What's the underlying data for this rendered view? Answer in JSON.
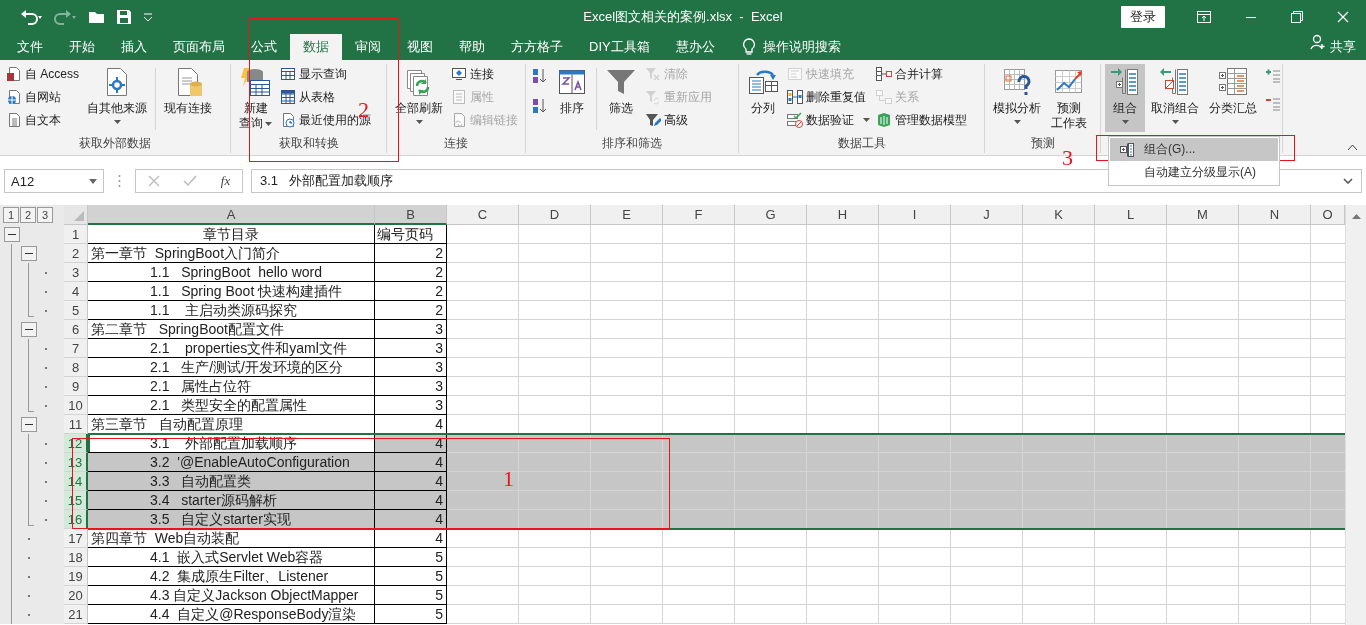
{
  "title_bar": {
    "title": "Excel图文相关的案例.xlsx  -  Excel",
    "sign_in": "登录",
    "redo_disabled": true
  },
  "tabs": [
    {
      "label": "文件",
      "selected": false
    },
    {
      "label": "开始",
      "selected": false
    },
    {
      "label": "插入",
      "selected": false
    },
    {
      "label": "页面布局",
      "selected": false
    },
    {
      "label": "公式",
      "selected": false
    },
    {
      "label": "数据",
      "selected": true
    },
    {
      "label": "审阅",
      "selected": false
    },
    {
      "label": "视图",
      "selected": false
    },
    {
      "label": "帮助",
      "selected": false
    },
    {
      "label": "方方格子",
      "selected": false
    },
    {
      "label": "DIY工具箱",
      "selected": false
    },
    {
      "label": "慧办公",
      "selected": false
    }
  ],
  "tell_me": "操作说明搜索",
  "share": "共享",
  "ribbon_groups": [
    {
      "label": "获取外部数据",
      "items": [
        {
          "kind": "stack",
          "items": [
            {
              "label": "自 Access",
              "disabled": false,
              "dropdown": false
            },
            {
              "label": "自网站",
              "disabled": false,
              "dropdown": false
            },
            {
              "label": "自文本",
              "disabled": false,
              "dropdown": false
            }
          ]
        },
        {
          "kind": "large",
          "lines": [
            "自其他来源"
          ],
          "dropdown": true,
          "pressed": false
        },
        {
          "kind": "separator"
        },
        {
          "kind": "large",
          "lines": [
            "现有连接"
          ],
          "dropdown": false,
          "pressed": false
        }
      ]
    },
    {
      "label": "获取和转换",
      "items": [
        {
          "kind": "large",
          "lines": [
            "新建",
            "查询"
          ],
          "dropdown": true,
          "pressed": false
        },
        {
          "kind": "stack",
          "items": [
            {
              "label": "显示查询",
              "disabled": false,
              "dropdown": false
            },
            {
              "label": "从表格",
              "disabled": false,
              "dropdown": false
            },
            {
              "label": "最近使用的源",
              "disabled": false,
              "dropdown": false
            }
          ]
        }
      ]
    },
    {
      "label": "连接",
      "items": [
        {
          "kind": "large",
          "lines": [
            "全部刷新"
          ],
          "dropdown": true,
          "pressed": false
        },
        {
          "kind": "stack",
          "items": [
            {
              "label": "连接",
              "disabled": false,
              "dropdown": false
            },
            {
              "label": "属性",
              "disabled": true,
              "dropdown": false
            },
            {
              "label": "编辑链接",
              "disabled": true,
              "dropdown": false
            }
          ]
        }
      ]
    },
    {
      "label": "排序和筛选",
      "items": [
        {
          "kind": "sort-icons"
        },
        {
          "kind": "large",
          "lines": [
            "排序"
          ],
          "dropdown": false,
          "pressed": false
        },
        {
          "kind": "separator"
        },
        {
          "kind": "large",
          "lines": [
            "筛选"
          ],
          "dropdown": false,
          "pressed": false
        },
        {
          "kind": "stack",
          "items": [
            {
              "label": "清除",
              "disabled": true,
              "dropdown": false
            },
            {
              "label": "重新应用",
              "disabled": true,
              "dropdown": false
            },
            {
              "label": "高级",
              "disabled": false,
              "dropdown": false
            }
          ]
        }
      ]
    },
    {
      "label": "数据工具",
      "items": [
        {
          "kind": "large",
          "lines": [
            "分列"
          ],
          "dropdown": false,
          "pressed": false
        },
        {
          "kind": "stack",
          "items": [
            {
              "label": "快速填充",
              "disabled": true,
              "dropdown": false
            },
            {
              "label": "删除重复值",
              "disabled": false,
              "dropdown": false
            },
            {
              "label": "数据验证",
              "disabled": false,
              "dropdown": true
            }
          ]
        },
        {
          "kind": "stack",
          "items": [
            {
              "label": "合并计算",
              "disabled": false,
              "dropdown": false
            },
            {
              "label": "关系",
              "disabled": true,
              "dropdown": false
            },
            {
              "label": "管理数据模型",
              "disabled": false,
              "dropdown": false
            }
          ]
        }
      ]
    },
    {
      "label": "预测",
      "items": [
        {
          "kind": "large",
          "lines": [
            "模拟分析"
          ],
          "dropdown": true,
          "pressed": false
        },
        {
          "kind": "large",
          "lines": [
            "预测",
            "工作表"
          ],
          "dropdown": false,
          "pressed": false
        }
      ]
    },
    {
      "items": [
        {
          "kind": "large",
          "lines": [
            "组合"
          ],
          "dropdown": true,
          "pressed": true
        },
        {
          "kind": "large",
          "lines": [
            "取消组合"
          ],
          "dropdown": true,
          "pressed": false
        },
        {
          "kind": "large",
          "lines": [
            "分类汇总"
          ],
          "dropdown": false,
          "pressed": false
        },
        {
          "kind": "detail-icons"
        }
      ]
    }
  ],
  "menu": {
    "items": [
      {
        "label": "组合(G)...",
        "highlighted": true
      },
      {
        "label": "自动建立分级显示(A)",
        "highlighted": false
      }
    ]
  },
  "formula_bar": {
    "name_box": "A12",
    "function_label": "fx",
    "value": "3.1   外部配置加载顺序"
  },
  "outline_levels": [
    "1",
    "2",
    "3"
  ],
  "columns": [
    {
      "label": "A",
      "highlighted": true
    },
    {
      "label": "B",
      "highlighted": true
    },
    {
      "label": "C",
      "highlighted": false
    },
    {
      "label": "D",
      "highlighted": false
    },
    {
      "label": "E",
      "highlighted": false
    },
    {
      "label": "F",
      "highlighted": false
    },
    {
      "label": "G",
      "highlighted": false
    },
    {
      "label": "H",
      "highlighted": false
    },
    {
      "label": "I",
      "highlighted": false
    },
    {
      "label": "J",
      "highlighted": false
    },
    {
      "label": "K",
      "highlighted": false
    },
    {
      "label": "L",
      "highlighted": false
    },
    {
      "label": "M",
      "highlighted": false
    },
    {
      "label": "N",
      "highlighted": false
    },
    {
      "label": "O",
      "highlighted": false
    }
  ],
  "rows": [
    {
      "number": "1",
      "kind": "header",
      "a": "章节目录",
      "b": "编号页码",
      "outline": {
        "kind": "button1"
      },
      "selected": false,
      "active": false
    },
    {
      "number": "2",
      "kind": "chapter",
      "a": "第一章节  SpringBoot入门简介",
      "b": "2",
      "outline": {
        "kind": "button2"
      },
      "selected": false,
      "active": false
    },
    {
      "number": "3",
      "kind": "section",
      "a": "1.1   SpringBoot  hello word",
      "b": "2",
      "outline": {
        "kind": "dot3"
      },
      "selected": false,
      "active": false
    },
    {
      "number": "4",
      "kind": "section",
      "a": "1.1   Spring Boot 快速构建插件",
      "b": "2",
      "outline": {
        "kind": "dot3"
      },
      "selected": false,
      "active": false
    },
    {
      "number": "5",
      "kind": "section",
      "a": "1.1    主启动类源码探究",
      "b": "2",
      "outline": {
        "kind": "dot3"
      },
      "selected": false,
      "active": false
    },
    {
      "number": "6",
      "kind": "chapter",
      "a": "第二章节   SpringBoot配置文件",
      "b": "3",
      "outline": {
        "kind": "button2"
      },
      "selected": false,
      "active": false
    },
    {
      "number": "7",
      "kind": "section",
      "a": "2.1    properties文件和yaml文件",
      "b": "3",
      "outline": {
        "kind": "dot3"
      },
      "selected": false,
      "active": false
    },
    {
      "number": "8",
      "kind": "section",
      "a": "2.1   生产/测试/开发环境的区分",
      "b": "3",
      "outline": {
        "kind": "dot3"
      },
      "selected": false,
      "active": false
    },
    {
      "number": "9",
      "kind": "section",
      "a": "2.1   属性占位符",
      "b": "3",
      "outline": {
        "kind": "dot3"
      },
      "selected": false,
      "active": false
    },
    {
      "number": "10",
      "kind": "section",
      "a": "2.1   类型安全的配置属性",
      "b": "3",
      "outline": {
        "kind": "dot3"
      },
      "selected": false,
      "active": false
    },
    {
      "number": "11",
      "kind": "chapter",
      "a": "第三章节   自动配置原理",
      "b": "4",
      "outline": {
        "kind": "button2"
      },
      "selected": false,
      "active": false
    },
    {
      "number": "12",
      "kind": "section",
      "a": "3.1    外部配置加载顺序",
      "b": "4",
      "outline": {
        "kind": "dot3"
      },
      "selected": true,
      "active": true
    },
    {
      "number": "13",
      "kind": "section",
      "a": "3.2  '@EnableAutoConfiguration",
      "b": "4",
      "outline": {
        "kind": "dot3"
      },
      "selected": true,
      "active": false
    },
    {
      "number": "14",
      "kind": "section",
      "a": "3.3   自动配置类",
      "b": "4",
      "outline": {
        "kind": "dot3"
      },
      "selected": true,
      "active": false
    },
    {
      "number": "15",
      "kind": "section",
      "a": "3.4   starter源码解析",
      "b": "4",
      "outline": {
        "kind": "dot3"
      },
      "selected": true,
      "active": false
    },
    {
      "number": "16",
      "kind": "section",
      "a": "3.5   自定义starter实现",
      "b": "4",
      "outline": {
        "kind": "dot3"
      },
      "selected": true,
      "active": false
    },
    {
      "number": "17",
      "kind": "chapter",
      "a": "第四章节  Web自动装配",
      "b": "4",
      "outline": {
        "kind": "dot2"
      },
      "selected": false,
      "active": false
    },
    {
      "number": "18",
      "kind": "section",
      "a": "4.1  嵌入式Servlet Web容器",
      "b": "5",
      "outline": {
        "kind": "dot2"
      },
      "selected": false,
      "active": false
    },
    {
      "number": "19",
      "kind": "section",
      "a": "4.2  集成原生Filter、Listener",
      "b": "5",
      "outline": {
        "kind": "dot2"
      },
      "selected": false,
      "active": false
    },
    {
      "number": "20",
      "kind": "section",
      "a": "4.3 自定义Jackson ObjectMapper",
      "b": "5",
      "outline": {
        "kind": "dot2"
      },
      "selected": false,
      "active": false
    },
    {
      "number": "21",
      "kind": "section",
      "a": "4.4  自定义@ResponseBody渲染",
      "b": "5",
      "outline": {
        "kind": "dot2"
      },
      "selected": false,
      "active": false
    }
  ],
  "annotations": [
    {
      "label": "1"
    },
    {
      "label": "2"
    },
    {
      "label": "3"
    }
  ]
}
